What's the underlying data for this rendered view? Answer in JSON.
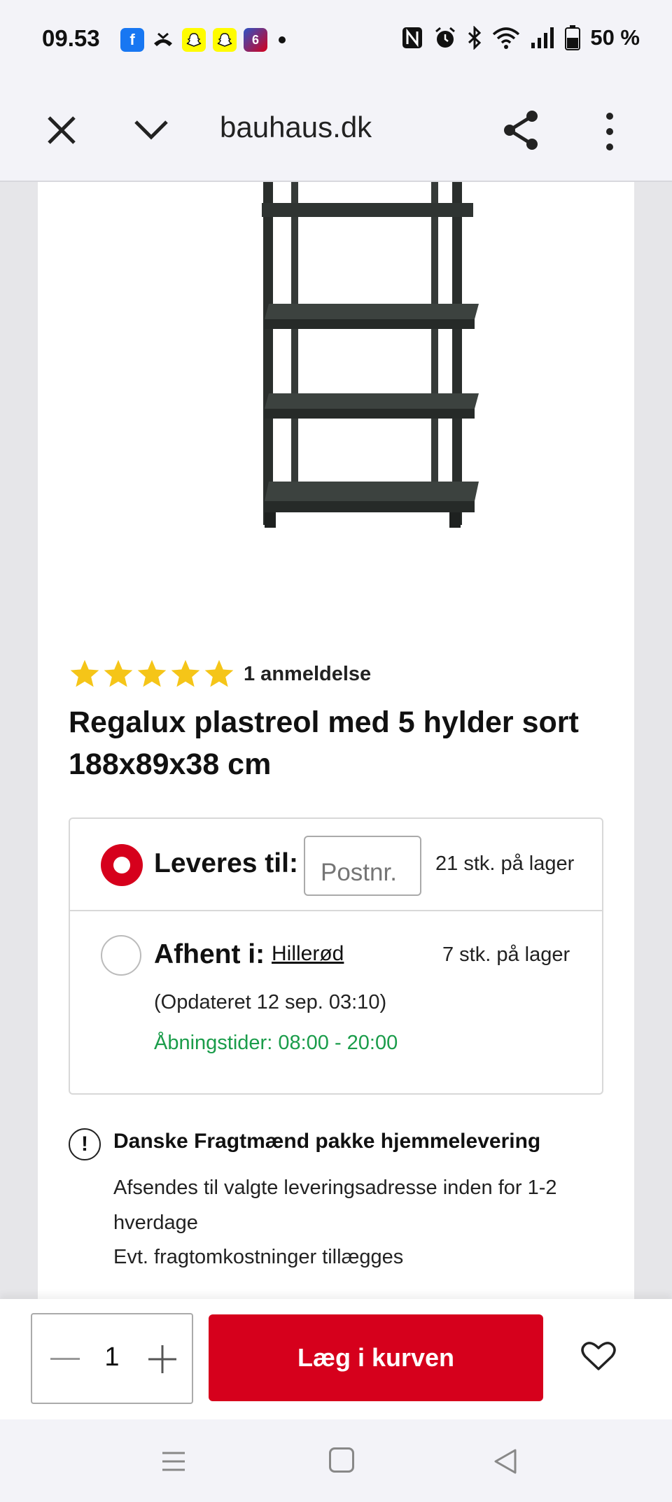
{
  "status_bar": {
    "time": "09.53",
    "battery": "50 %",
    "notification_icons": [
      "facebook-icon",
      "missed-call-icon",
      "snapchat-icon",
      "snapchat-icon",
      "tv2-icon"
    ]
  },
  "browser": {
    "domain": "bauhaus.dk"
  },
  "product": {
    "rating_stars": 5,
    "rating_text": "1 anmeldelse",
    "title": "Regalux plastreol med 5 hylder sort 188x89x38 cm"
  },
  "delivery": {
    "option_deliver_label": "Leveres til:",
    "postnr_placeholder": "Postnr.",
    "deliver_stock": "21 stk. på lager",
    "option_pickup_label": "Afhent i:",
    "store_name": "Hillerød",
    "pickup_stock": "7 stk. på lager",
    "updated": "(Opdateret 12 sep. 03:10)",
    "opening_hours": "Åbningstider: 08:00 - 20:00"
  },
  "shipping_info": {
    "title": "Danske Fragtmænd pakke hjemmelevering",
    "line1": "Afsendes til valgte leveringsadresse inden for 1-2 hverdage",
    "line2": "Evt. fragtomkostninger tillægges"
  },
  "cart": {
    "quantity": "1",
    "add_to_cart_label": "Læg i kurven"
  },
  "colors": {
    "accent": "#d6001c",
    "success": "#1a9c4a"
  }
}
